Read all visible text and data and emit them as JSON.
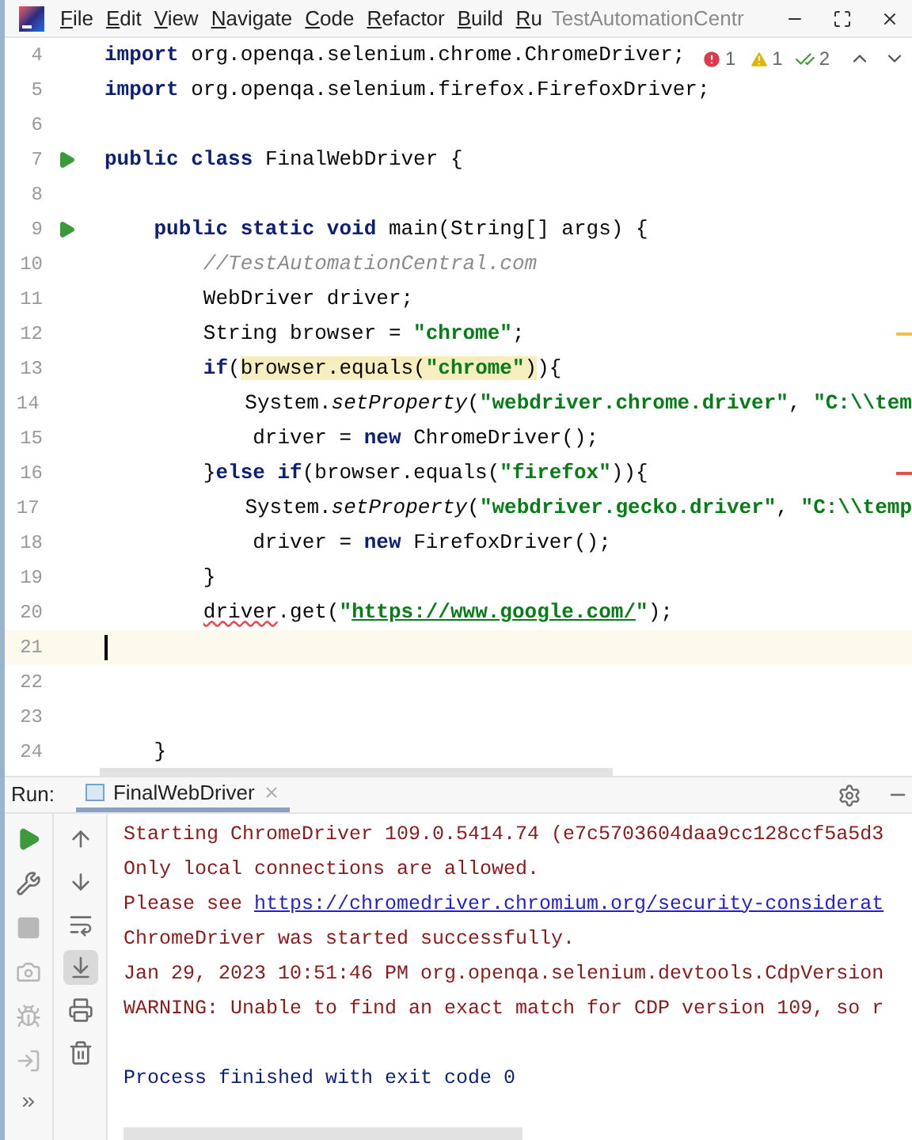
{
  "menu_bar": {
    "items": [
      "File",
      "Edit",
      "View",
      "Navigate",
      "Code",
      "Refactor",
      "Build",
      "Ru"
    ],
    "title": "TestAutomationCentr"
  },
  "inspections": [
    {
      "kind": "error",
      "count": "1"
    },
    {
      "kind": "warning",
      "count": "1"
    },
    {
      "kind": "typo",
      "count": "2"
    }
  ],
  "editor": {
    "lines": [
      {
        "number": "4",
        "runnable": false,
        "current": false,
        "tokens": [
          {
            "kind": "keyword",
            "text": "import"
          },
          {
            "kind": "plain",
            "text": " org.openqa.selenium.chrome.ChromeDriver;"
          }
        ]
      },
      {
        "number": "5",
        "runnable": false,
        "current": false,
        "tokens": [
          {
            "kind": "keyword",
            "text": "import"
          },
          {
            "kind": "plain",
            "text": " org.openqa.selenium.firefox.FirefoxDriver;"
          }
        ]
      },
      {
        "number": "6",
        "runnable": false,
        "current": false
      },
      {
        "number": "7",
        "runnable": true,
        "current": false,
        "tokens": [
          {
            "kind": "keyword",
            "text": "public class"
          },
          {
            "kind": "plain",
            "text": " FinalWebDriver {"
          }
        ]
      },
      {
        "number": "8",
        "runnable": false,
        "current": false
      },
      {
        "number": "9",
        "runnable": true,
        "current": false,
        "tokens": [
          {
            "kind": "keyword",
            "text": "    public static void"
          },
          {
            "kind": "plain",
            "text": " main(String[] args) {"
          }
        ]
      },
      {
        "number": "10",
        "runnable": false,
        "current": false,
        "tokens": [
          {
            "kind": "comment",
            "text": "        //TestAutomationCentral.com"
          }
        ]
      },
      {
        "number": "11",
        "runnable": false,
        "current": false,
        "tokens": [
          {
            "kind": "plain",
            "text": "        WebDriver driver;"
          }
        ]
      },
      {
        "number": "12",
        "runnable": false,
        "current": false,
        "tokens": [
          {
            "kind": "plain",
            "text": "        String browser = "
          },
          {
            "kind": "string",
            "text": "\"chrome\""
          },
          {
            "kind": "plain",
            "text": ";"
          }
        ]
      },
      {
        "number": "13",
        "runnable": false,
        "current": false,
        "tokens": [
          {
            "kind": "keyword",
            "text": "        if"
          },
          {
            "kind": "plain",
            "text": "("
          },
          {
            "kind": "plain",
            "text": "browser.equals(",
            "highlighted": true
          },
          {
            "kind": "string",
            "text": "\"chrome\"",
            "highlighted": true
          },
          {
            "kind": "plain",
            "text": ")",
            "highlighted": true
          },
          {
            "kind": "plain",
            "text": "){"
          }
        ]
      },
      {
        "number": "14",
        "runnable": false,
        "current": false,
        "tokens": [
          {
            "kind": "plain",
            "text": "            System."
          },
          {
            "kind": "italic",
            "text": "setProperty"
          },
          {
            "kind": "plain",
            "text": "("
          },
          {
            "kind": "string",
            "text": "\"webdriver.chrome.driver\""
          },
          {
            "kind": "plain",
            "text": ", "
          },
          {
            "kind": "string",
            "text": "\"C:\\\\tem"
          }
        ]
      },
      {
        "number": "15",
        "runnable": false,
        "current": false,
        "tokens": [
          {
            "kind": "plain",
            "text": "            driver = "
          },
          {
            "kind": "keyword",
            "text": "new"
          },
          {
            "kind": "plain",
            "text": " ChromeDriver();"
          }
        ]
      },
      {
        "number": "16",
        "runnable": false,
        "current": false,
        "tokens": [
          {
            "kind": "plain",
            "text": "        }"
          },
          {
            "kind": "keyword",
            "text": "else if"
          },
          {
            "kind": "plain",
            "text": "(browser.equals("
          },
          {
            "kind": "string",
            "text": "\"firefox\""
          },
          {
            "kind": "plain",
            "text": ")){"
          }
        ]
      },
      {
        "number": "17",
        "runnable": false,
        "current": false,
        "tokens": [
          {
            "kind": "plain",
            "text": "            System."
          },
          {
            "kind": "italic",
            "text": "setProperty"
          },
          {
            "kind": "plain",
            "text": "("
          },
          {
            "kind": "string",
            "text": "\"webdriver.gecko.driver\""
          },
          {
            "kind": "plain",
            "text": ", "
          },
          {
            "kind": "string",
            "text": "\"C:\\\\temp"
          }
        ]
      },
      {
        "number": "18",
        "runnable": false,
        "current": false,
        "tokens": [
          {
            "kind": "plain",
            "text": "            driver = "
          },
          {
            "kind": "keyword",
            "text": "new"
          },
          {
            "kind": "plain",
            "text": " FirefoxDriver();"
          }
        ]
      },
      {
        "number": "19",
        "runnable": false,
        "current": false,
        "tokens": [
          {
            "kind": "plain",
            "text": "        }"
          }
        ]
      },
      {
        "number": "20",
        "runnable": false,
        "current": false,
        "tokens": [
          {
            "kind": "squiggle",
            "text": "        driver"
          },
          {
            "kind": "plain",
            "text": ".get("
          },
          {
            "kind": "string",
            "text": "\""
          },
          {
            "kind": "link",
            "text": "https://www.google.com/"
          },
          {
            "kind": "string",
            "text": "\""
          },
          {
            "kind": "plain",
            "text": ");"
          }
        ]
      },
      {
        "number": "21",
        "runnable": false,
        "current": true
      },
      {
        "number": "22",
        "runnable": false,
        "current": false
      },
      {
        "number": "23",
        "runnable": false,
        "current": false
      },
      {
        "number": "24",
        "runnable": false,
        "current": false,
        "tokens": [
          {
            "kind": "plain",
            "text": "    }"
          }
        ]
      }
    ]
  },
  "run_panel": {
    "label": "Run:",
    "tab": "FinalWebDriver",
    "left_tools": [
      {
        "kind": "run",
        "disabled": false
      },
      {
        "kind": "wrench",
        "disabled": false
      },
      {
        "kind": "stop",
        "disabled": true
      },
      {
        "kind": "camera",
        "disabled": true
      },
      {
        "kind": "bug",
        "disabled": true
      },
      {
        "kind": "exit",
        "disabled": true
      },
      {
        "kind": "more",
        "disabled": false
      }
    ],
    "console_tools": [
      {
        "kind": "up",
        "selected": false
      },
      {
        "kind": "down",
        "selected": false
      },
      {
        "kind": "wrap",
        "selected": false
      },
      {
        "kind": "scroll-end",
        "selected": true
      },
      {
        "kind": "print",
        "selected": false
      },
      {
        "kind": "trash",
        "selected": false
      }
    ],
    "console": [
      {
        "kind": "stderr",
        "tokens": [
          {
            "text": "Starting ChromeDriver 109.0.5414.74 (e7c5703604daa9cc128ccf5a5d3"
          }
        ]
      },
      {
        "kind": "stderr",
        "tokens": [
          {
            "text": "Only local connections are allowed."
          }
        ]
      },
      {
        "kind": "stderr",
        "tokens": [
          {
            "text": "Please see "
          },
          {
            "text": "https://chromedriver.chromium.org/security-considerat",
            "link": true
          }
        ]
      },
      {
        "kind": "stderr",
        "tokens": [
          {
            "text": "ChromeDriver was started successfully."
          }
        ]
      },
      {
        "kind": "stderr",
        "tokens": [
          {
            "text": "Jan 29, 2023 10:51:46 PM org.openqa.selenium.devtools.CdpVersion"
          }
        ]
      },
      {
        "kind": "stderr",
        "tokens": [
          {
            "text": "WARNING: Unable to find an exact match for CDP version 109, so r"
          }
        ]
      },
      {
        "kind": "system",
        "tokens": [
          {
            "text": "Process finished with exit code 0"
          }
        ]
      }
    ]
  }
}
